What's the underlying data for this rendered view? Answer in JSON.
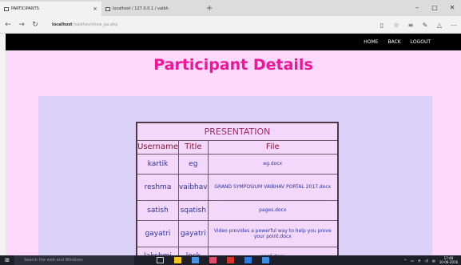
{
  "browser": {
    "tabs": [
      {
        "title": "PARTICIPANTS",
        "active": true
      },
      {
        "title": "localhost / 127.0.0.1 / vaibh",
        "active": false
      }
    ],
    "new_tab": "+",
    "window_controls": [
      "–",
      "□",
      "✕"
    ],
    "url_host": "localhost",
    "url_path": "/vaibhav/show_pa.php"
  },
  "nav": {
    "items": [
      "HOME",
      "BACK",
      "LOGOUT"
    ]
  },
  "page": {
    "title": "Participant Details"
  },
  "table": {
    "caption": "PRESENTATION",
    "headers": [
      "Username",
      "Title",
      "File"
    ],
    "rows": [
      {
        "username": "kartik",
        "title": "eg",
        "file": "eg.docx"
      },
      {
        "username": "reshma",
        "title": "vaibhav",
        "file": "GRAND SYMPOSIUM VAIBHAV PORTAL 2017.docx"
      },
      {
        "username": "satish",
        "title": "sqatish",
        "file": "pages.docx"
      },
      {
        "username": "gayatri",
        "title": "gayatri",
        "file": "Video provides a powerful way to help you prove your point.docx"
      },
      {
        "username": "lakshmi",
        "title": "lock",
        "file": "word.docx"
      }
    ]
  },
  "taskbar": {
    "search_placeholder": "Search the web and Windows",
    "time": "17:48",
    "date": "10-06-2016",
    "colors": {
      "explorer": "#f5c518",
      "store": "#4a90e2",
      "mail": "#e34b6a",
      "acrobat": "#d9342b",
      "ie": "#2b7de1",
      "app": "#3a8ee6"
    }
  },
  "colors": {
    "page_bg": "#ffd9fc",
    "panel_bg": "#dcd2f7",
    "title": "#ee1599",
    "navbar": "#000000"
  }
}
